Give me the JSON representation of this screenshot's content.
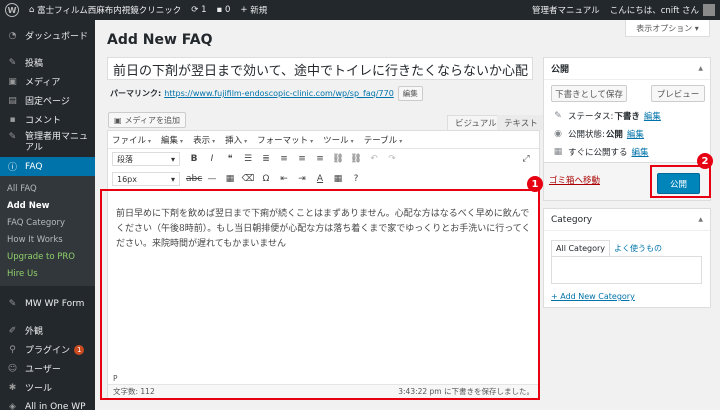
{
  "adminbar": {
    "logo": "W",
    "site_name": "富士フィルム西麻布内視鏡クリニック",
    "updates_count": "1",
    "comments_count": "0",
    "new_label": "新規",
    "manual": "管理者マニュアル",
    "greeting": "こんにちは、cnift さん"
  },
  "sidebar": {
    "dashboard": "ダッシュボード",
    "posts": "投稿",
    "media": "メディア",
    "pages": "固定ページ",
    "comments": "コメント",
    "manual": "管理者用マニュアル",
    "faq": "FAQ",
    "sub": {
      "all": "All FAQ",
      "add_new": "Add New",
      "category": "FAQ Category",
      "how": "How It Works",
      "upgrade": "Upgrade to PRO",
      "hire": "Hire Us"
    },
    "mw_form": "MW WP Form",
    "appearance": "外観",
    "plugins": "プラグイン",
    "plugins_badge": "1",
    "users": "ユーザー",
    "tools": "ツール",
    "allinone": "All in One WP"
  },
  "screen_options": "表示オプション",
  "page_title": "Add New FAQ",
  "post_title": "前日の下剤が翌日まで効いて、途中でトイレに行きたくならないか心配",
  "permalink": {
    "label": "パーマリンク:",
    "url": "https://www.fujifilm-endoscopic-clinic.com/wp/sp_faq/770",
    "edit": "編集"
  },
  "editor": {
    "add_media": "メディアを追加",
    "tab_visual": "ビジュアル",
    "tab_text": "テキスト",
    "menus": [
      "ファイル",
      "編集",
      "表示",
      "挿入",
      "フォーマット",
      "ツール",
      "テーブル"
    ],
    "format_select": "段落",
    "size_select": "16px",
    "content": "前日早めに下剤を飲めば翌日まで下痢が続くことはまずありません。心配な方はなるべく早めに飲んでください（午後8時前）。もし当日朝排便が心配な方は落ち着くまで家でゆっくりとお手洗いに行ってください。来院時間が遅れてもかまいません",
    "path": "P",
    "word_count": "文字数: 112",
    "draft_saved": "3:43:22 pm に下書きを保存しました。"
  },
  "publish": {
    "title": "公開",
    "save_draft": "下書きとして保存",
    "preview": "プレビュー",
    "status_label": "ステータス:",
    "status_value": "下書き",
    "visibility_label": "公開状態:",
    "visibility_value": "公開",
    "schedule_label": "すぐに公開する",
    "edit": "編集",
    "trash": "ゴミ箱へ移動",
    "publish_button": "公開"
  },
  "category": {
    "title": "Category",
    "tab_all": "All Category",
    "tab_popular": "よく使うもの",
    "add_new": "+ Add New Category"
  },
  "callouts": {
    "one": "1",
    "two": "2",
    "color": "#e60012"
  }
}
